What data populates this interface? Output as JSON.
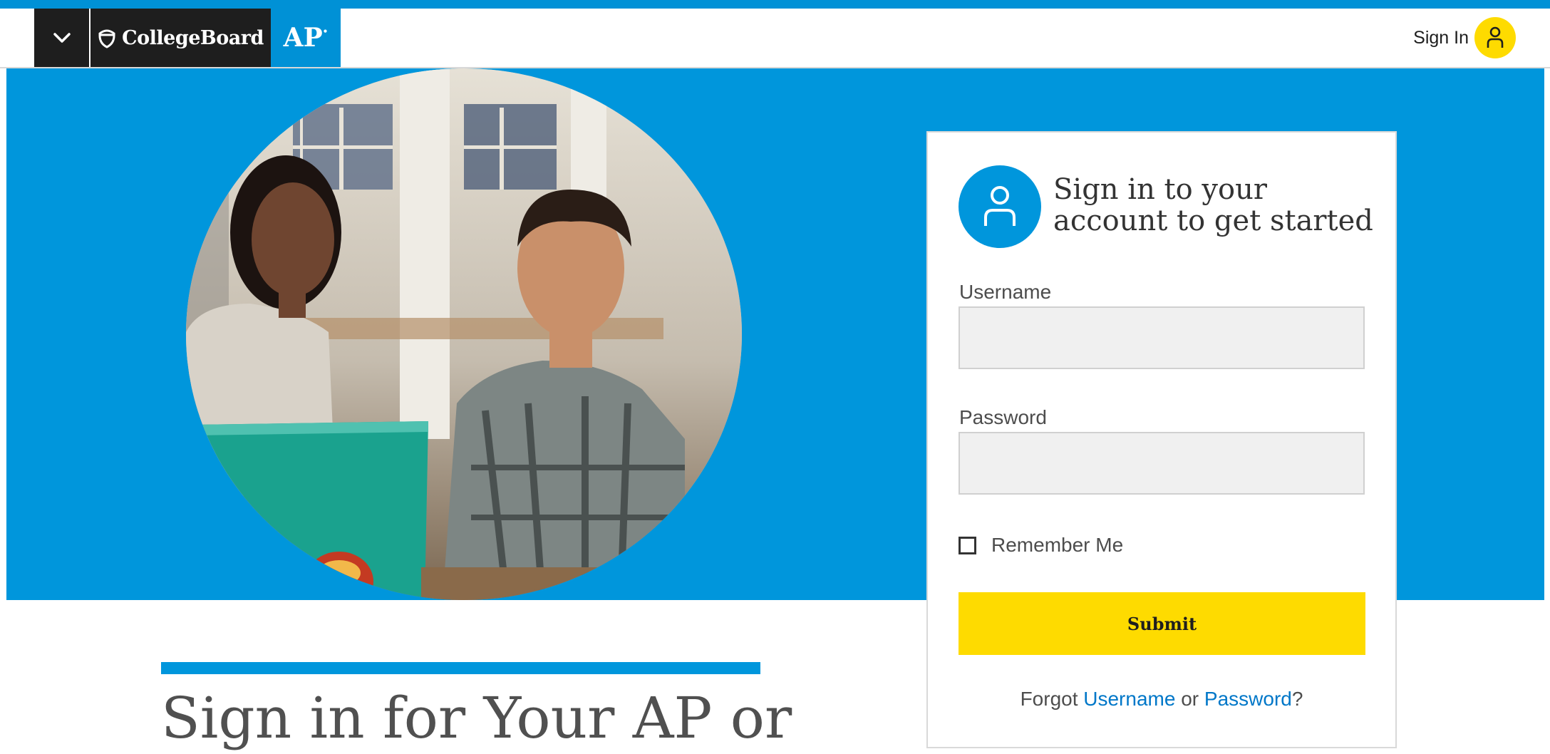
{
  "header": {
    "menu_toggle_icon": "chevron-down-icon",
    "brand_name": "CollegeBoard",
    "brand_icon": "acorn-icon",
    "program_logo": "AP",
    "sign_in_label": "Sign In",
    "sign_in_icon": "user-icon"
  },
  "hero": {
    "image": "photo of two smiling students looking up, one with a green laptop"
  },
  "login_card": {
    "icon": "user-icon",
    "title": "Sign in to your account to get started",
    "username_label": "Username",
    "username_value": "",
    "password_label": "Password",
    "password_value": "",
    "remember_label": "Remember Me",
    "remember_checked": false,
    "submit_label": "Submit",
    "forgot_prefix": "Forgot ",
    "forgot_username": "Username",
    "forgot_middle": " or ",
    "forgot_password": "Password",
    "forgot_suffix": "?"
  },
  "content": {
    "heading": "Sign in for Your AP or"
  },
  "colors": {
    "brand_blue": "#0096dc",
    "brand_yellow": "#fedb00",
    "dark": "#1e1e1e",
    "link": "#0077c8"
  }
}
